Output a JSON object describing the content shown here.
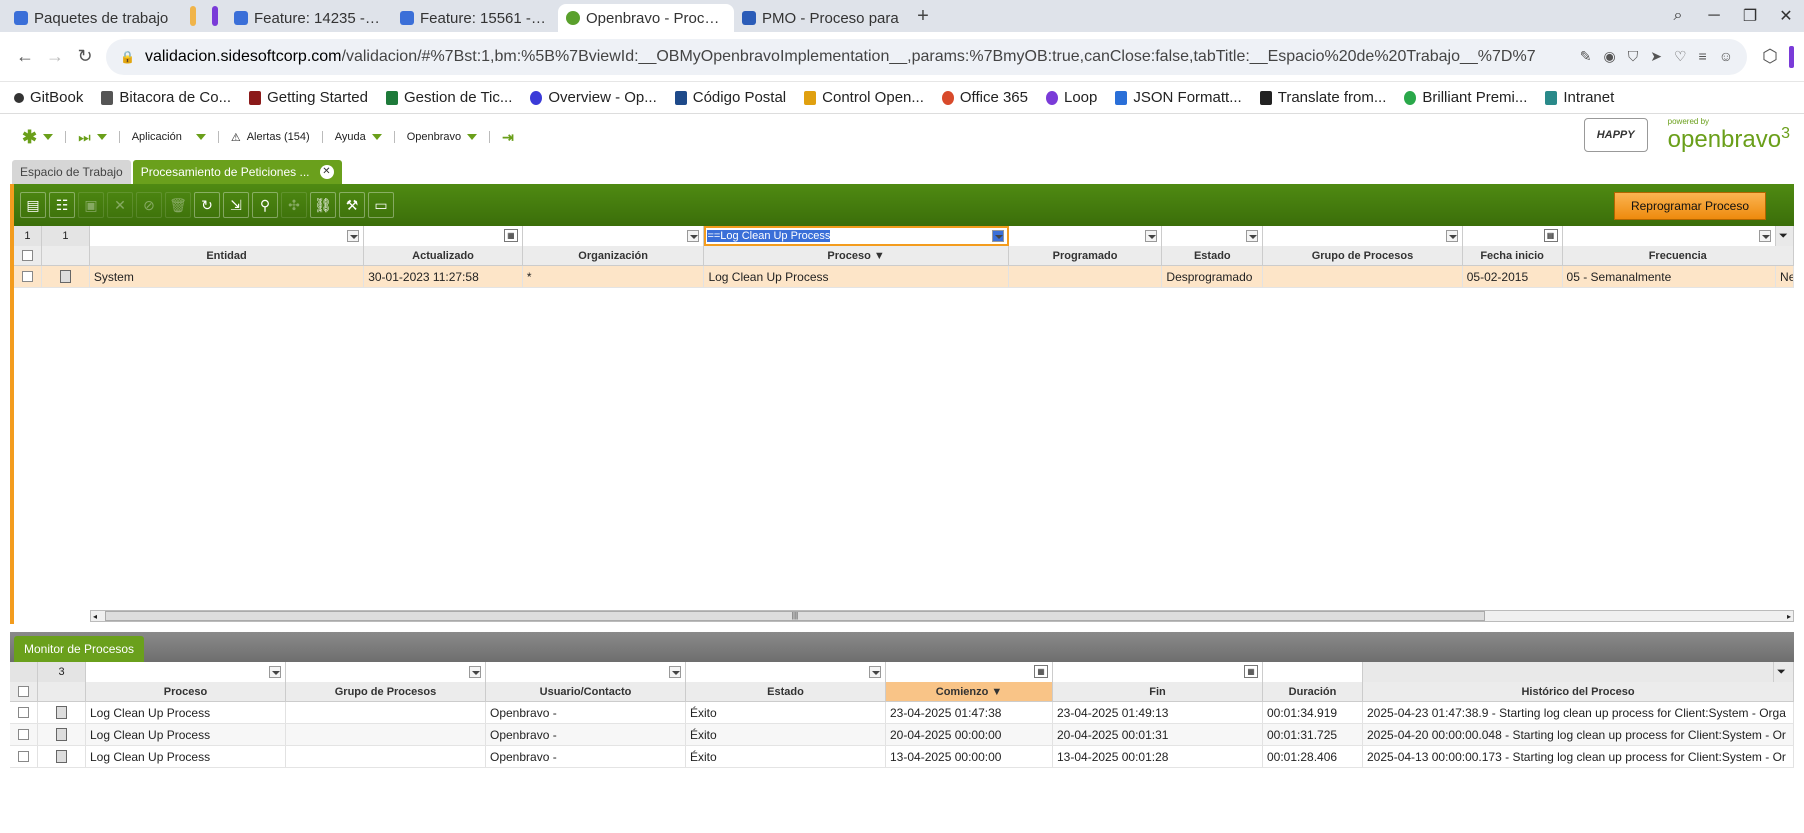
{
  "browser": {
    "tabs": [
      {
        "label": "Paquetes de trabajo",
        "color": "#3b6fd8"
      },
      {
        "label": "Feature: 14235 - Des",
        "color": "#3b6fd8"
      },
      {
        "label": "Feature: 15561 - BUG",
        "color": "#3b6fd8"
      },
      {
        "label": "Openbravo - Proceso",
        "color": "#5aa02c"
      },
      {
        "label": "PMO - Proceso para",
        "color": "#2b5cb8"
      }
    ],
    "url_domain": "validacion.sidesoftcorp.com",
    "url_path": "/validacion/#%7Bst:1,bm:%5B%7BviewId:__OBMyOpenbravoImplementation__,params:%7BmyOB:true,canClose:false,tabTitle:__Espacio%20de%20Trabajo__%7D%7"
  },
  "bookmarks": [
    {
      "label": "GitBook",
      "color": "#333"
    },
    {
      "label": "Bitacora de Co...",
      "color": "#555"
    },
    {
      "label": "Getting Started",
      "color": "#8b1a1a"
    },
    {
      "label": "Gestion de Tic...",
      "color": "#1e7a3a"
    },
    {
      "label": "Overview - Op...",
      "color": "#3b3bd8"
    },
    {
      "label": "Código Postal",
      "color": "#1e4a8a"
    },
    {
      "label": "Control Open...",
      "color": "#e0a010"
    },
    {
      "label": "Office 365",
      "color": "#d84a2b"
    },
    {
      "label": "Loop",
      "color": "#7a3bd8"
    },
    {
      "label": "JSON Formatt...",
      "color": "#2a6fd8"
    },
    {
      "label": "Translate from...",
      "color": "#222"
    },
    {
      "label": "Brilliant Premi...",
      "color": "#2aa84a"
    },
    {
      "label": "Intranet",
      "color": "#2a8a8a"
    }
  ],
  "ob_menu": {
    "aplicacion": "Aplicación",
    "alertas": "Alertas (154)",
    "ayuda": "Ayuda",
    "openbravo": "Openbravo",
    "happy": "HAPPY",
    "powered": "powered by",
    "brand": "openbravo",
    "brand_num": "3"
  },
  "window_tabs": {
    "workspace": "Espacio de Trabajo",
    "current": "Procesamiento de Peticiones ..."
  },
  "toolbar": {
    "reprogram": "Reprogramar Proceso"
  },
  "top_grid": {
    "count_a": "1",
    "count_b": "1",
    "filter_proceso": "==Log Clean Up Process",
    "headers": [
      "Entidad",
      "Actualizado",
      "Organización",
      "Proceso ▼",
      "Programado",
      "Estado",
      "Grupo de Procesos",
      "Fecha inicio",
      "Frecuencia"
    ],
    "row": {
      "entidad": "System",
      "actualizado": "30-01-2023 11:27:58",
      "organizacion": "*",
      "proceso": "Log Clean Up Process",
      "programado": "",
      "estado": "Desprogramado",
      "grupo": "",
      "fecha_inicio": "05-02-2015",
      "frecuencia": "05 - Semanalmente",
      "extra": "Ne"
    }
  },
  "monitor": {
    "tab": "Monitor de Procesos",
    "count": "3",
    "headers": [
      "Proceso",
      "Grupo de Procesos",
      "Usuario/Contacto",
      "Estado",
      "Comienzo ▼",
      "Fin",
      "Duración",
      "Histórico del Proceso"
    ],
    "rows": [
      {
        "proceso": "Log Clean Up Process",
        "grupo": "",
        "usuario": "Openbravo -",
        "estado": "Éxito",
        "comienzo": "23-04-2025 01:47:38",
        "fin": "23-04-2025 01:49:13",
        "duracion": "00:01:34.919",
        "historico": "2025-04-23 01:47:38.9 - Starting log clean up process for Client:System - Orga"
      },
      {
        "proceso": "Log Clean Up Process",
        "grupo": "",
        "usuario": "Openbravo -",
        "estado": "Éxito",
        "comienzo": "20-04-2025 00:00:00",
        "fin": "20-04-2025 00:01:31",
        "duracion": "00:01:31.725",
        "historico": "2025-04-20 00:00:00.048 - Starting log clean up process for Client:System - Or"
      },
      {
        "proceso": "Log Clean Up Process",
        "grupo": "",
        "usuario": "Openbravo -",
        "estado": "Éxito",
        "comienzo": "13-04-2025 00:00:00",
        "fin": "13-04-2025 00:01:28",
        "duracion": "00:01:28.406",
        "historico": "2025-04-13 00:00:00.173 - Starting log clean up process for Client:System - Or"
      }
    ]
  }
}
